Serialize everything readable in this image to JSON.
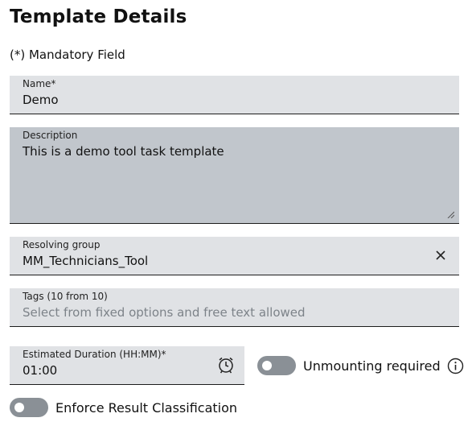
{
  "page": {
    "title": "Template Details",
    "mandatory_note": "(*) Mandatory Field"
  },
  "form": {
    "name": {
      "label": "Name*",
      "value": "Demo"
    },
    "description": {
      "label": "Description",
      "value": "This is a demo tool task template"
    },
    "resolving_group": {
      "label": "Resolving group",
      "value": "MM_Technicians_Tool"
    },
    "tags": {
      "label": "Tags (10 from 10)",
      "placeholder": "Select from fixed options and free text allowed"
    },
    "estimated_duration": {
      "label": "Estimated Duration (HH:MM)*",
      "value": "01:00"
    },
    "unmounting_required": {
      "label": "Unmounting required",
      "checked": false
    },
    "enforce_result_classification": {
      "label": "Enforce Result Classification",
      "checked": false
    }
  },
  "icons": {
    "clear": "close-icon",
    "duration": "alarm-clock-icon",
    "info": "info-icon"
  },
  "colors": {
    "field_bg": "#e0e2e5",
    "description_bg": "#c1c6cc",
    "toggle_off": "#8a9096"
  }
}
